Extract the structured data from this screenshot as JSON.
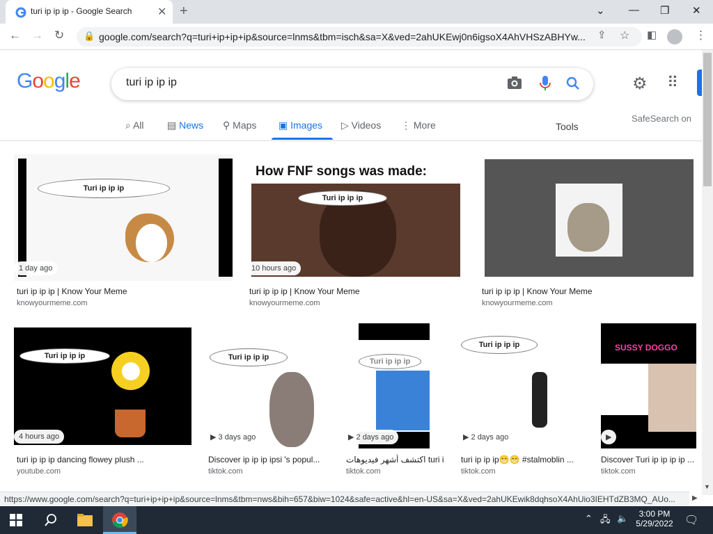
{
  "browser": {
    "tab_title": "turi ip ip ip - Google Search",
    "url": "google.com/search?q=turi+ip+ip+ip&source=lnms&tbm=isch&sa=X&ved=2ahUKEwj0n6igsoX4AhVHSzABHYw...",
    "status_url": "https://www.google.com/search?q=turi+ip+ip+ip&source=lnms&tbm=nws&bih=657&biw=1024&safe=active&hl=en-US&sa=X&ved=2ahUKEwik8dqhsoX4AhUio3IEHTdZB3MQ_AUo..."
  },
  "search": {
    "query": "turi ip ip ip",
    "logo": "Google",
    "tabs": [
      "All",
      "News",
      "Maps",
      "Images",
      "Videos",
      "More"
    ],
    "tools": "Tools",
    "safesearch": "SafeSearch on"
  },
  "results": [
    {
      "badge": "1 day ago",
      "title": "turi ip ip ip | Know Your Meme",
      "source": "knowyourmeme.com"
    },
    {
      "badge": "10 hours ago",
      "title": "turi ip ip ip | Know Your Meme",
      "source": "knowyourmeme.com",
      "caption": "How FNF songs was made:"
    },
    {
      "badge": "",
      "title": "turi ip ip ip | Know Your Meme",
      "source": "knowyourmeme.com"
    },
    {
      "badge": "4 hours ago",
      "title": "turi ip ip ip dancing flowey plush ...",
      "source": "youtube.com"
    },
    {
      "badge": "3 days ago",
      "title": "Discover ip ip ip ipsi 's popul...",
      "source": "tiktok.com"
    },
    {
      "badge": "2 days ago",
      "title": "اكتشف أشهر فيديوهات turi ip ...",
      "source": "tiktok.com"
    },
    {
      "badge": "2 days ago",
      "title": "turi ip ip ip😁😁 #stalmoblin ...",
      "source": "tiktok.com"
    },
    {
      "badge": "",
      "title": "Discover Turi ip ip ip ip ...",
      "source": "tiktok.com",
      "caption": "SUSSY DOGGO"
    }
  ],
  "bubble_text": "Turi ip ip ip",
  "taskbar": {
    "time": "3:00 PM",
    "date": "5/29/2022"
  }
}
